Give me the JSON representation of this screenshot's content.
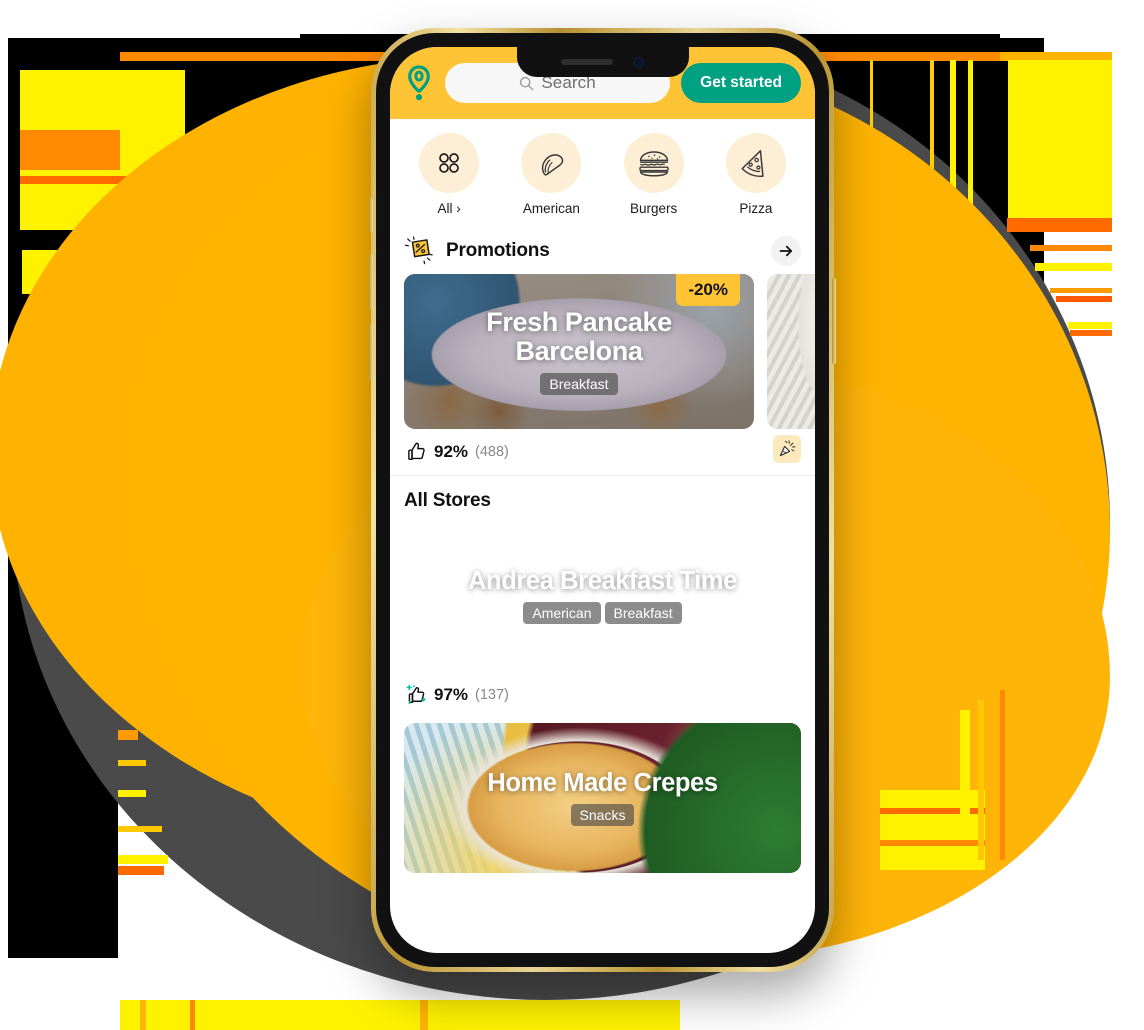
{
  "theme": {
    "header_yellow": "#FFC436",
    "brand_green": "#00A082",
    "accent_cream": "#FDEFD5",
    "bg_orange": "#FFB400",
    "bg_dark": "#4A4A4A"
  },
  "header": {
    "logo_icon": "location-pin-icon",
    "search": {
      "placeholder": "Search",
      "value": "",
      "icon": "search-icon"
    },
    "cta_label": "Get started"
  },
  "categories": [
    {
      "label": "All ›",
      "icon": "grid-four-dots-icon"
    },
    {
      "label": "American",
      "icon": "taco-icon"
    },
    {
      "label": "Burgers",
      "icon": "burger-icon"
    },
    {
      "label": "Pizza",
      "icon": "pizza-slice-icon"
    }
  ],
  "promotions": {
    "title": "Promotions",
    "icon": "discount-tag-icon",
    "next_icon": "arrow-right-icon",
    "cards": [
      {
        "title": "Fresh Pancake Barcelona",
        "title_line1": "Fresh Pancake",
        "title_line2": "Barcelona",
        "tags": [
          "Breakfast"
        ],
        "discount": "-20%",
        "rating_pct": "92%",
        "rating_count": "(488)",
        "rating_icon": "thumbs-up-icon",
        "promo_badge_icon": "party-popper-icon"
      },
      {
        "title": "",
        "tags": [],
        "discount": "",
        "rating_pct": "",
        "rating_count": ""
      }
    ]
  },
  "all_stores": {
    "title": "All Stores",
    "cards": [
      {
        "title": "Andrea Breakfast Time",
        "tags": [
          "American",
          "Breakfast"
        ],
        "rating_pct": "97%",
        "rating_count": "(137)",
        "rating_icon": "thumbs-up-sparkle-icon"
      },
      {
        "title": "Home Made Crepes",
        "tags": [
          "Snacks"
        ],
        "rating_pct": "",
        "rating_count": ""
      }
    ]
  }
}
